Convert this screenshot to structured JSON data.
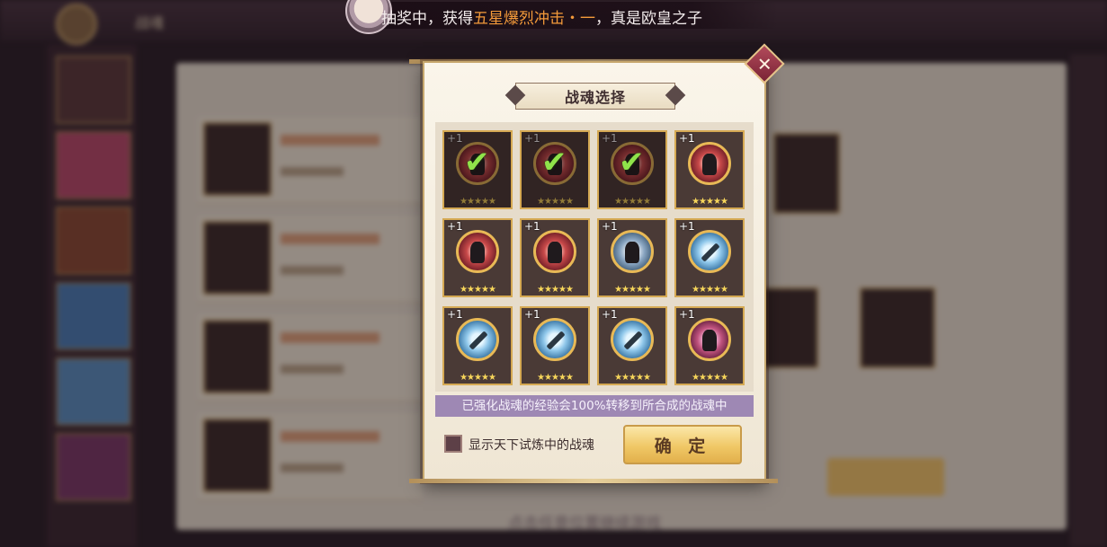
{
  "notice": {
    "prefix": "抽奖中，获得",
    "highlight": "五星爆烈冲击・一",
    "suffix": "，真是欧皇之子"
  },
  "modal": {
    "title": "战魂选择",
    "info": "已强化战魂的经验会100%转移到所合成的战魂中",
    "checkbox_label": "显示天下试炼中的战魂",
    "confirm_label": "确 定",
    "close_icon": "✕"
  },
  "cards": [
    {
      "level": "+1",
      "stars": "★★★★★",
      "emblem": "red",
      "selected": true
    },
    {
      "level": "+1",
      "stars": "★★★★★",
      "emblem": "red",
      "selected": true
    },
    {
      "level": "+1",
      "stars": "★★★★★",
      "emblem": "red",
      "selected": true
    },
    {
      "level": "+1",
      "stars": "★★★★★",
      "emblem": "red",
      "selected": false
    },
    {
      "level": "+1",
      "stars": "★★★★★",
      "emblem": "red",
      "selected": false
    },
    {
      "level": "+1",
      "stars": "★★★★★",
      "emblem": "red",
      "selected": false
    },
    {
      "level": "+1",
      "stars": "★★★★★",
      "emblem": "gray",
      "selected": false
    },
    {
      "level": "+1",
      "stars": "★★★★★",
      "emblem": "blue",
      "selected": false
    },
    {
      "level": "+1",
      "stars": "★★★★★",
      "emblem": "blue",
      "selected": false
    },
    {
      "level": "+1",
      "stars": "★★★★★",
      "emblem": "blue",
      "selected": false
    },
    {
      "level": "+1",
      "stars": "★★★★★",
      "emblem": "blue",
      "selected": false
    },
    {
      "level": "+1",
      "stars": "★★★★★",
      "emblem": "pink",
      "selected": false
    }
  ],
  "background": {
    "header_title": "战魂",
    "bottom_hint": "点击任意位置继续游戏"
  },
  "colors": {
    "highlight": "#f39a3a",
    "info_bar": "#9e88b4",
    "confirm": "#f0c866"
  }
}
